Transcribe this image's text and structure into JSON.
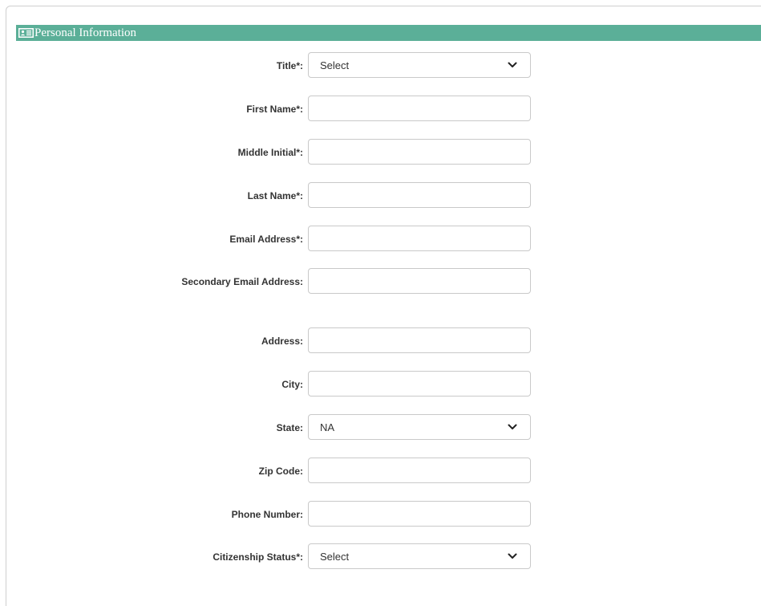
{
  "section": {
    "title": "Personal Information",
    "icon": "id-card-icon",
    "header_color": "#5baf98"
  },
  "fields": {
    "title": {
      "label": "Title*:",
      "value": "Select"
    },
    "first_name": {
      "label": "First Name*:",
      "value": ""
    },
    "middle_initial": {
      "label": "Middle Initial*:",
      "value": ""
    },
    "last_name": {
      "label": "Last Name*:",
      "value": ""
    },
    "email": {
      "label": "Email Address*:",
      "value": ""
    },
    "secondary_email": {
      "label": "Secondary Email Address:",
      "value": ""
    },
    "address": {
      "label": "Address:",
      "value": ""
    },
    "city": {
      "label": "City:",
      "value": ""
    },
    "state": {
      "label": "State:",
      "value": "NA"
    },
    "zip_code": {
      "label": "Zip Code:",
      "value": ""
    },
    "phone_number": {
      "label": "Phone Number:",
      "value": ""
    },
    "citizenship_status": {
      "label": "Citizenship Status*:",
      "value": "Select"
    }
  }
}
